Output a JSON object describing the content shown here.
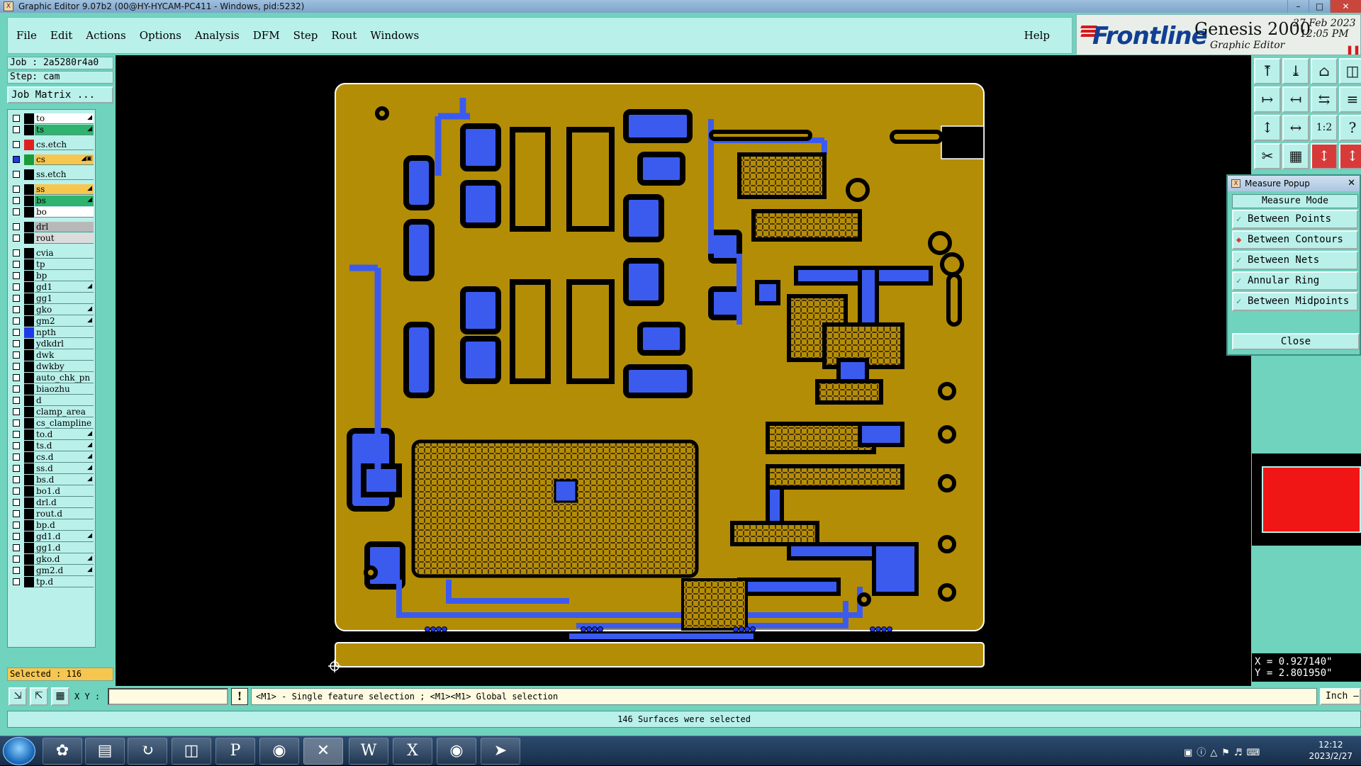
{
  "window": {
    "title": "Graphic Editor 9.07b2 (00@HY-HYCAM-PC411 - Windows, pid:5232)"
  },
  "menu": [
    "File",
    "Edit",
    "Actions",
    "Options",
    "Analysis",
    "DFM",
    "Step",
    "Rout",
    "Windows"
  ],
  "help_label": "Help",
  "branding": {
    "logo": "Frontline",
    "product": "Genesis 2000",
    "subtitle": "Graphic Editor",
    "date": "27 Feb 2023",
    "time": "12:05 PM"
  },
  "job": {
    "label": "Job : 2a5280r4a0",
    "step": "Step: cam",
    "matrix_button": "Job Matrix ..."
  },
  "layers": [
    {
      "name": "to",
      "color": "#000000",
      "bg": "#ffffff",
      "mark": "◢"
    },
    {
      "name": "ts",
      "color": "#000000",
      "bg": "#2fb36e",
      "mark": "◢"
    },
    {
      "gap": true
    },
    {
      "name": "cs.etch",
      "color": "#e02020",
      "bg": "#b9f0ea",
      "mark": ""
    },
    {
      "gap": true
    },
    {
      "name": "cs",
      "color": "#1c9b3a",
      "bg": "#f7c64f",
      "mark": "◢▣",
      "active": true
    },
    {
      "gap": true
    },
    {
      "name": "ss.etch",
      "color": "#000000",
      "bg": "#b9f0ea",
      "mark": ""
    },
    {
      "gap": true
    },
    {
      "name": "ss",
      "color": "#000000",
      "bg": "#f7c64f",
      "mark": "◢"
    },
    {
      "name": "bs",
      "color": "#000000",
      "bg": "#2fb36e",
      "mark": "◢"
    },
    {
      "name": "bo",
      "color": "#000000",
      "bg": "#ffffff",
      "mark": ""
    },
    {
      "gap": true
    },
    {
      "name": "drl",
      "color": "#000000",
      "bg": "#b8b8b8",
      "mark": ""
    },
    {
      "name": "rout",
      "color": "#000000",
      "bg": "#dcdcdc",
      "mark": ""
    },
    {
      "gap": true
    },
    {
      "name": "cvia",
      "color": "#000000",
      "bg": "#b9f0ea",
      "mark": ""
    },
    {
      "name": "tp",
      "color": "#000000",
      "bg": "#b9f0ea",
      "mark": ""
    },
    {
      "name": "bp",
      "color": "#000000",
      "bg": "#b9f0ea",
      "mark": ""
    },
    {
      "name": "gd1",
      "color": "#000000",
      "bg": "#b9f0ea",
      "mark": "◢"
    },
    {
      "name": "gg1",
      "color": "#000000",
      "bg": "#b9f0ea",
      "mark": ""
    },
    {
      "name": "gko",
      "color": "#000000",
      "bg": "#b9f0ea",
      "mark": "◢"
    },
    {
      "name": "gm2",
      "color": "#000000",
      "bg": "#b9f0ea",
      "mark": "◢"
    },
    {
      "name": "npth",
      "color": "#1f38e8",
      "bg": "#b9f0ea",
      "mark": ""
    },
    {
      "name": "ydkdrl",
      "color": "#000000",
      "bg": "#b9f0ea",
      "mark": ""
    },
    {
      "name": "dwk",
      "color": "#000000",
      "bg": "#b9f0ea",
      "mark": ""
    },
    {
      "name": "dwkby",
      "color": "#000000",
      "bg": "#b9f0ea",
      "mark": ""
    },
    {
      "name": "auto_chk_pn",
      "color": "#000000",
      "bg": "#b9f0ea",
      "mark": ""
    },
    {
      "name": "biaozhu",
      "color": "#000000",
      "bg": "#b9f0ea",
      "mark": ""
    },
    {
      "name": "d",
      "color": "#000000",
      "bg": "#b9f0ea",
      "mark": ""
    },
    {
      "name": "clamp_area",
      "color": "#000000",
      "bg": "#b9f0ea",
      "mark": ""
    },
    {
      "name": "cs_clampline",
      "color": "#000000",
      "bg": "#b9f0ea",
      "mark": ""
    },
    {
      "name": "to.d",
      "color": "#000000",
      "bg": "#b9f0ea",
      "mark": "◢"
    },
    {
      "name": "ts.d",
      "color": "#000000",
      "bg": "#b9f0ea",
      "mark": "◢"
    },
    {
      "name": "cs.d",
      "color": "#000000",
      "bg": "#b9f0ea",
      "mark": "◢"
    },
    {
      "name": "ss.d",
      "color": "#000000",
      "bg": "#b9f0ea",
      "mark": "◢"
    },
    {
      "name": "bs.d",
      "color": "#000000",
      "bg": "#b9f0ea",
      "mark": "◢"
    },
    {
      "name": "bo1.d",
      "color": "#000000",
      "bg": "#b9f0ea",
      "mark": ""
    },
    {
      "name": "drl.d",
      "color": "#000000",
      "bg": "#b9f0ea",
      "mark": ""
    },
    {
      "name": "rout.d",
      "color": "#000000",
      "bg": "#b9f0ea",
      "mark": ""
    },
    {
      "name": "bp.d",
      "color": "#000000",
      "bg": "#b9f0ea",
      "mark": ""
    },
    {
      "name": "gd1.d",
      "color": "#000000",
      "bg": "#b9f0ea",
      "mark": "◢"
    },
    {
      "name": "gg1.d",
      "color": "#000000",
      "bg": "#b9f0ea",
      "mark": ""
    },
    {
      "name": "gko.d",
      "color": "#000000",
      "bg": "#b9f0ea",
      "mark": "◢"
    },
    {
      "name": "gm2.d",
      "color": "#000000",
      "bg": "#b9f0ea",
      "mark": "◢"
    },
    {
      "name": "tp.d",
      "color": "#000000",
      "bg": "#b9f0ea",
      "mark": ""
    }
  ],
  "selected": "Selected : 116",
  "measure_popup": {
    "title": "Measure Popup",
    "header": "Measure Mode",
    "options": [
      {
        "label": "Between Points",
        "selected": false
      },
      {
        "label": "Between Contours",
        "selected": true
      },
      {
        "label": "Between Nets",
        "selected": false
      },
      {
        "label": "Annular Ring",
        "selected": false
      },
      {
        "label": "Between Midpoints",
        "selected": false
      }
    ],
    "close": "Close"
  },
  "toolbox": [
    "⤒",
    "⤓",
    "⌂",
    "◫",
    "↦",
    "↤",
    "⇆",
    "≡",
    "↕",
    "↔",
    "1:2",
    "?",
    "✂",
    "▦",
    "↕",
    "↕"
  ],
  "coords": {
    "x": "X = 0.927140\"",
    "y": "Y = 2.801950\""
  },
  "xy_label": "X Y :",
  "xy_value": "",
  "hint": "<M1> - Single feature selection ; <M1><M1> Global selection",
  "units": "Inch —",
  "status": "146 Surfaces were selected",
  "clock": {
    "time": "12:12",
    "date": "2023/2/27"
  },
  "colors": {
    "board": "#b48d06",
    "copper": "#3b5bef",
    "trace": "#d28a1a",
    "outline": "#ffffff"
  }
}
